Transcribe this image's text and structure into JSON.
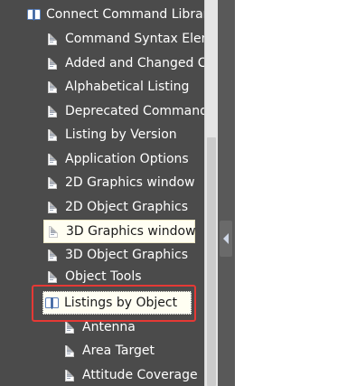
{
  "tree": {
    "items": [
      {
        "label": "Connect Command Library",
        "icon": "book-icon",
        "level": 0
      },
      {
        "label": "Command Syntax Elemen",
        "icon": "doc-icon",
        "level": 1
      },
      {
        "label": "Added and Changed Cor",
        "icon": "doc-icon",
        "level": 1
      },
      {
        "label": "Alphabetical Listing",
        "icon": "doc-icon",
        "level": 1
      },
      {
        "label": "Deprecated Commands",
        "icon": "doc-icon",
        "level": 1
      },
      {
        "label": "Listing by Version",
        "icon": "doc-icon",
        "level": 1
      },
      {
        "label": "Application Options",
        "icon": "doc-icon",
        "level": 1
      },
      {
        "label": "2D Graphics window",
        "icon": "doc-icon",
        "level": 1
      },
      {
        "label": "2D Object Graphics",
        "icon": "doc-icon",
        "level": 1
      },
      {
        "label": "3D Graphics window",
        "icon": "doc-icon",
        "level": 1,
        "state": "selected"
      },
      {
        "label": "3D Object Graphics",
        "icon": "doc-icon",
        "level": 1
      },
      {
        "label": "Object Tools",
        "icon": "doc-icon",
        "level": 1
      },
      {
        "label": "Listings by Object",
        "icon": "book-icon",
        "level": 1,
        "state": "focused"
      },
      {
        "label": "Antenna",
        "icon": "doc-icon",
        "level": 2
      },
      {
        "label": "Area Target",
        "icon": "doc-icon",
        "level": 2
      },
      {
        "label": "Attitude Coverage",
        "icon": "doc-icon",
        "level": 2
      }
    ]
  },
  "annotation": {
    "highlight_color": "#e53935"
  },
  "colors": {
    "tree_background": "#4b4b4b",
    "selected_background": "#fffef2",
    "divider": "#595959"
  }
}
